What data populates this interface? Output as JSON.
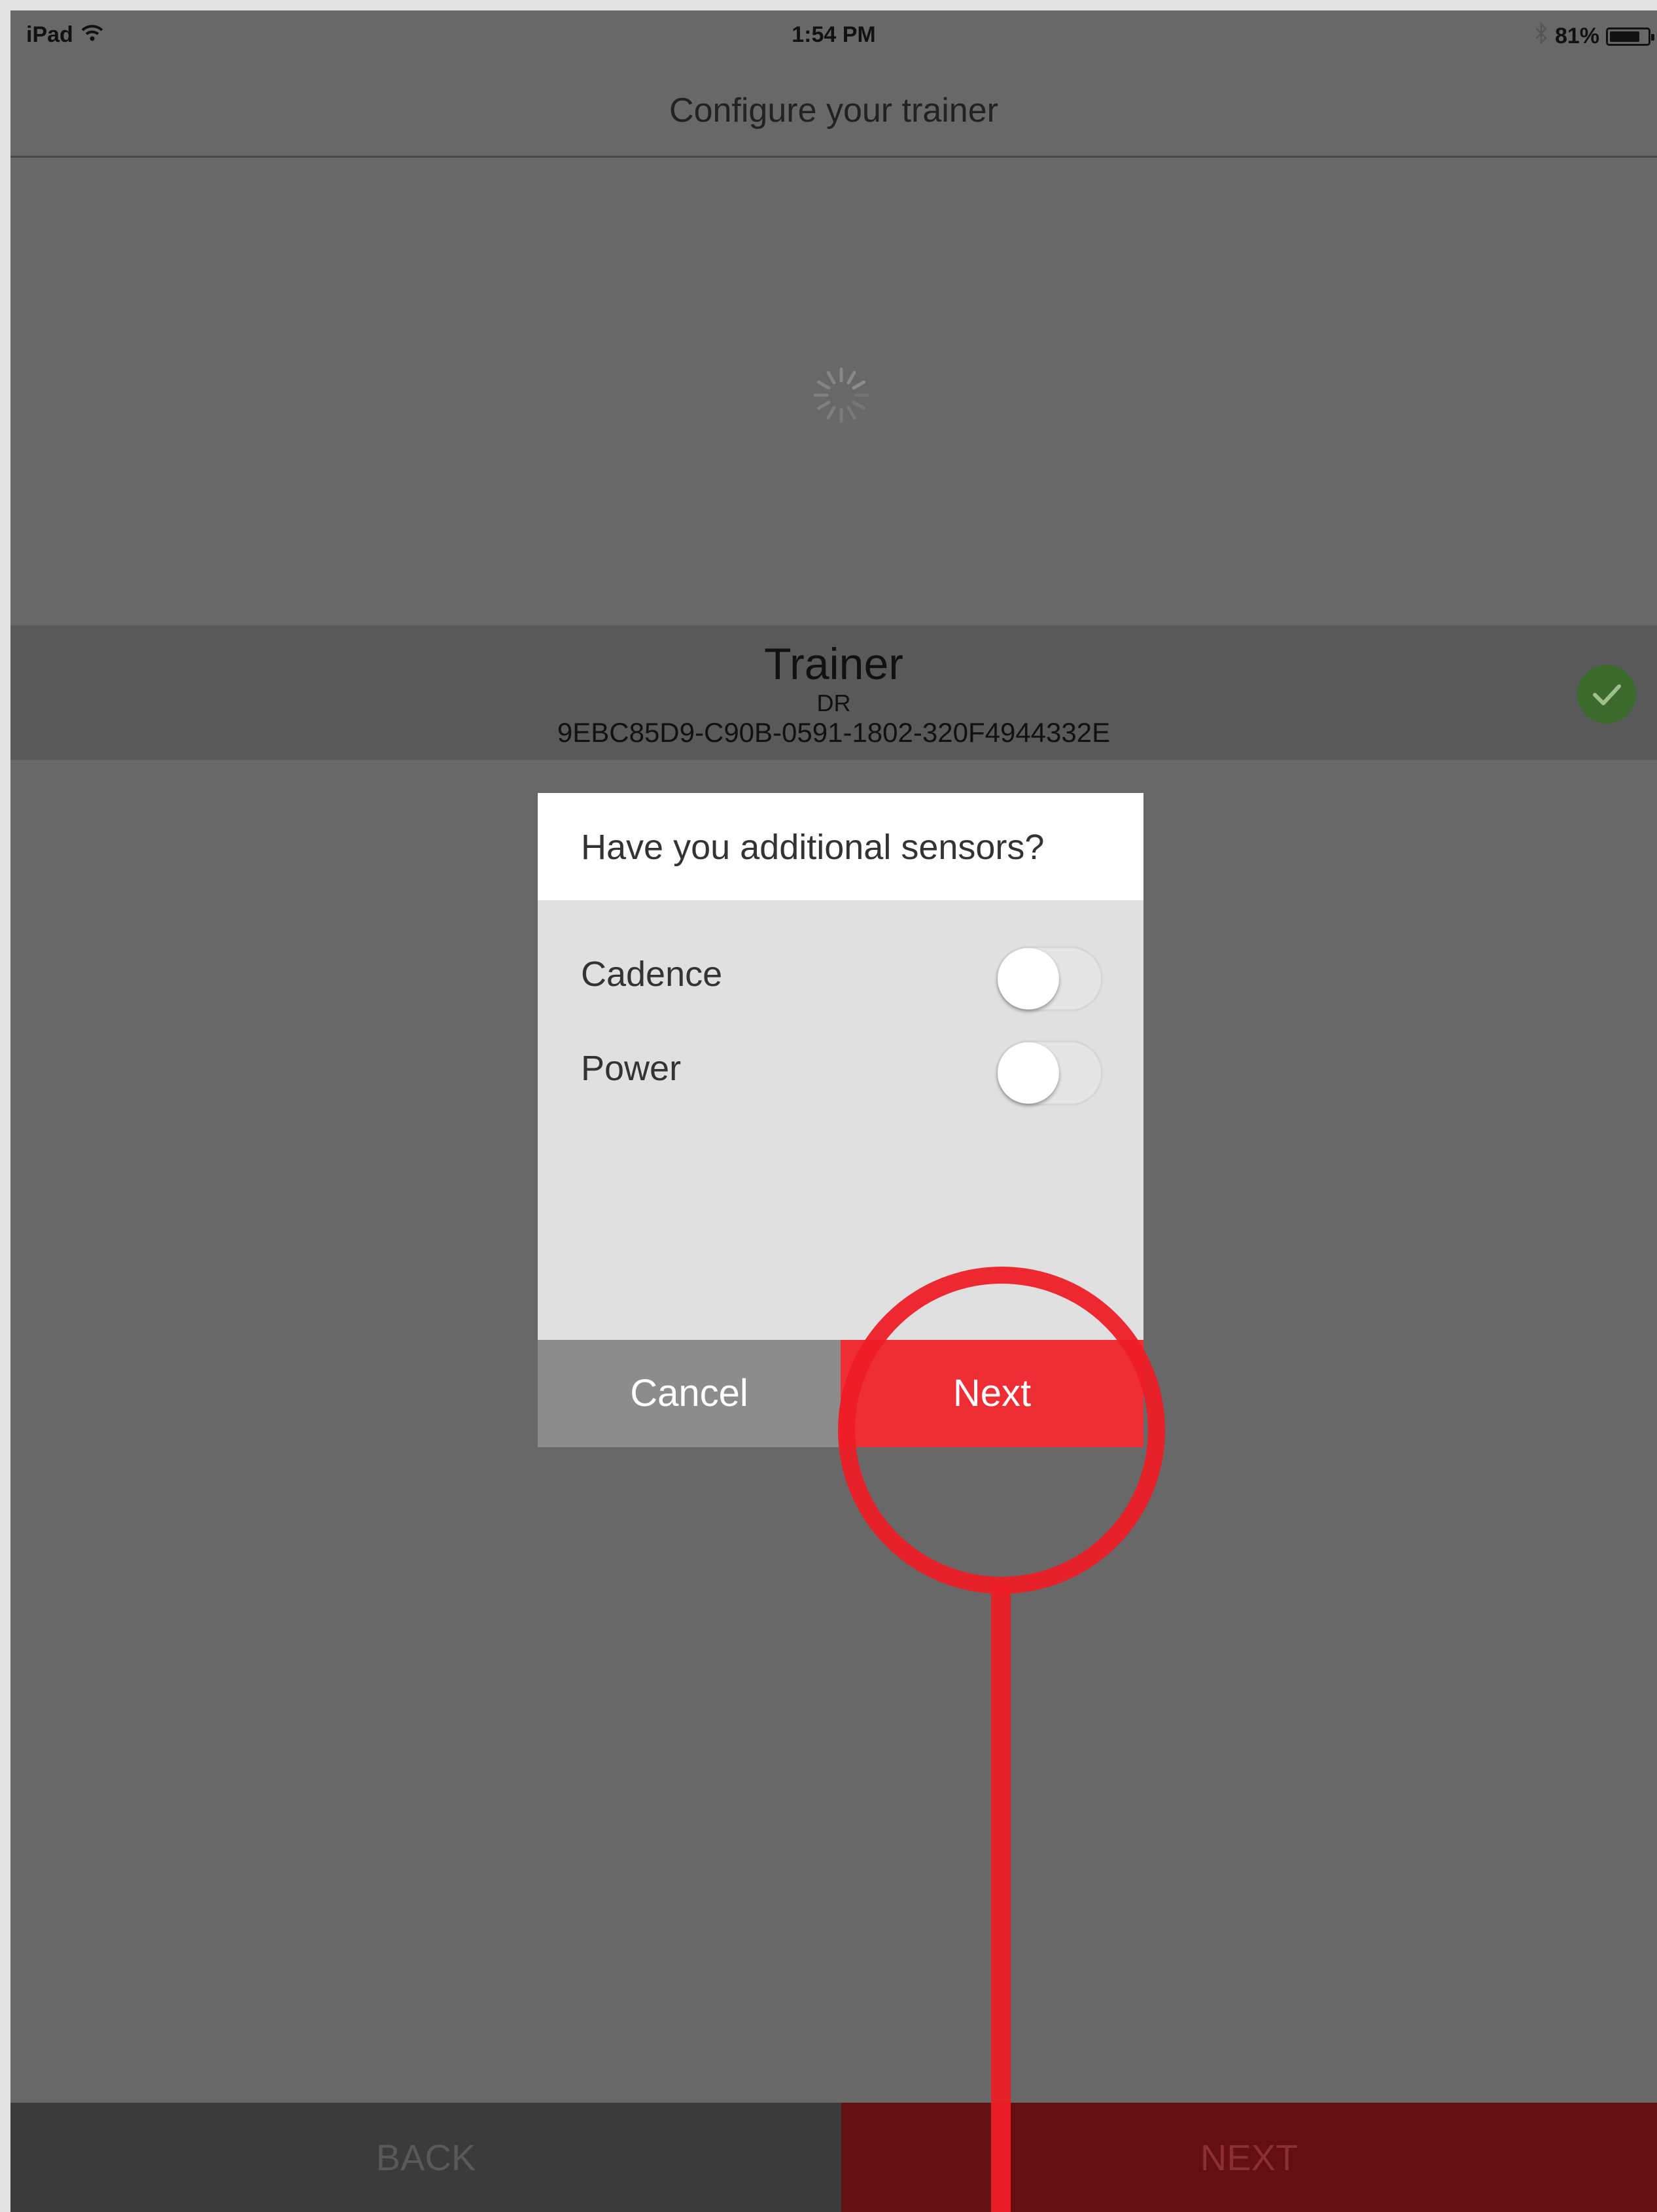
{
  "status_bar": {
    "device": "iPad",
    "time": "1:54 PM",
    "battery_percent": "81%",
    "battery_level": 0.81,
    "icons": [
      "wifi-icon",
      "bluetooth-icon",
      "battery-icon"
    ]
  },
  "nav": {
    "title": "Configure your trainer"
  },
  "trainer": {
    "name": "Trainer",
    "model": "DR",
    "id": "9EBC85D9-C90B-0591-1802-320F4944332E",
    "status_icon": "check-circle-icon",
    "status_color": "#3c6a2c"
  },
  "dialog": {
    "title": "Have you additional sensors?",
    "sensors": [
      {
        "label": "Cadence",
        "enabled": false
      },
      {
        "label": "Power",
        "enabled": false
      }
    ],
    "cancel_label": "Cancel",
    "next_label": "Next"
  },
  "bottom_bar": {
    "back_label": "BACK",
    "next_label": "NEXT"
  },
  "colors": {
    "accent": "#ee2e34",
    "highlight": "#ee1e26",
    "background": "#686868"
  }
}
